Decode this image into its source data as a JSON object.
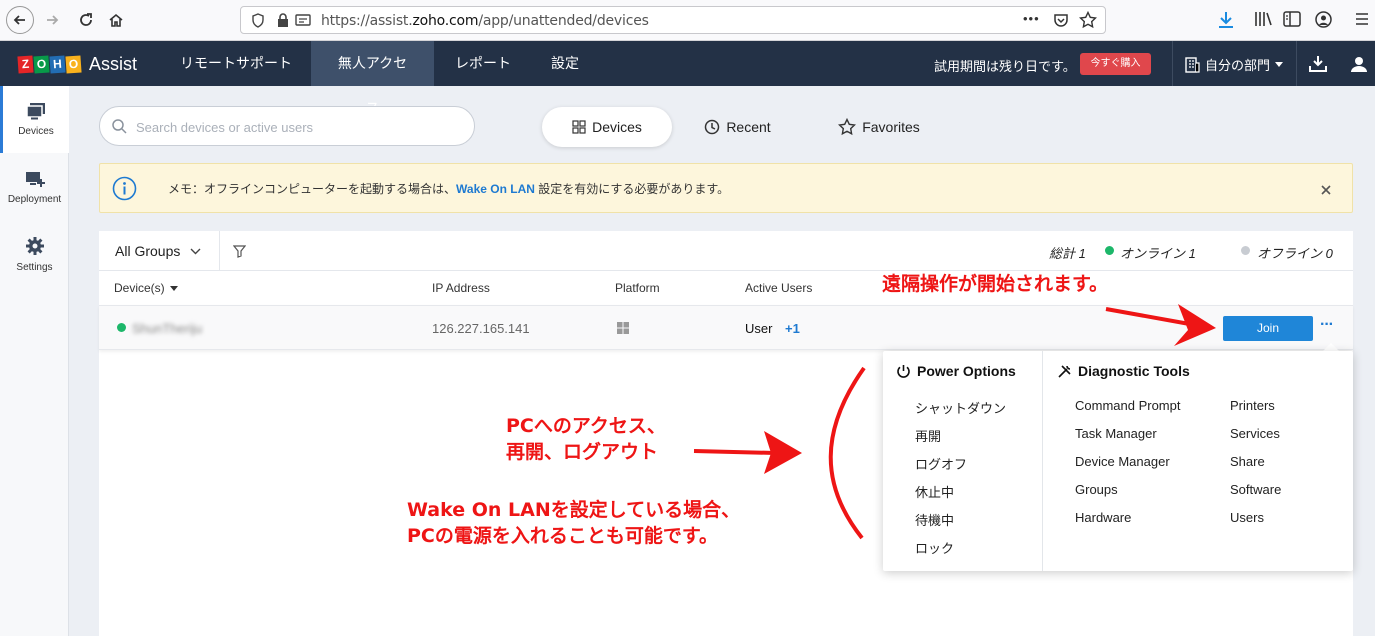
{
  "browser": {
    "url_host": "https://assist.",
    "url_domain": "zoho.com",
    "url_path": "/app/unattended/devices",
    "menu_dots": "•••"
  },
  "app": {
    "logo_letters": [
      "Z",
      "O",
      "H",
      "O"
    ],
    "logo_colors": [
      "#e42527",
      "#089949",
      "#226db4",
      "#f9b21d"
    ],
    "product_name": "Assist",
    "nav": [
      "リモートサポート",
      "無人アクセス",
      "レポート",
      "設定"
    ],
    "trial_text": "試用期間は残り日です。",
    "buy_label": "今すぐ購入",
    "dept_label": "自分の部門"
  },
  "sidebar": {
    "items": [
      {
        "label": "Devices",
        "icon": "devices-icon"
      },
      {
        "label": "Deployment",
        "icon": "deployment-icon"
      },
      {
        "label": "Settings",
        "icon": "settings-icon"
      }
    ]
  },
  "search": {
    "placeholder": "Search devices or active users"
  },
  "tabs": [
    "Devices",
    "Recent",
    "Favorites"
  ],
  "banner": {
    "pre": "メモ：オフラインコンピューターを起動する場合は、",
    "link": "Wake On LAN",
    "post": " 設定を有効にする必要があります。"
  },
  "filter": {
    "group": "All Groups",
    "total": "総計 1",
    "online": "オンライン 1",
    "offline": "オフライン 0"
  },
  "table": {
    "headers": [
      "Device(s)",
      "IP Address",
      "Platform",
      "Active Users"
    ],
    "row": {
      "device": "ShunTheriju",
      "ip": "126.227.165.141",
      "user": "User",
      "more_users": "+1",
      "join": "Join"
    }
  },
  "menu": {
    "power_title": "Power Options",
    "power_items": [
      "シャットダウン",
      "再開",
      "ログオフ",
      "休止中",
      "待機中",
      "ロック"
    ],
    "diag_title": "Diagnostic Tools",
    "diag_col1": [
      "Command Prompt",
      "Task Manager",
      "Device Manager",
      "Groups",
      "Hardware"
    ],
    "diag_col2": [
      "Printers",
      "Services",
      "Share",
      "Software",
      "Users"
    ]
  },
  "annotations": {
    "a1": "遠隔操作が開始されます。",
    "a2_line1": "PCへのアクセス、",
    "a2_line2": "再開、ログアウト",
    "a3_line1": "Wake On LANを設定している場合、",
    "a3_line2": "PCの電源を入れることも可能です。"
  },
  "colors": {
    "nav_bg": "#233146",
    "join": "#1f86d8",
    "online": "#1db76a",
    "annotation": "#ee1515"
  }
}
